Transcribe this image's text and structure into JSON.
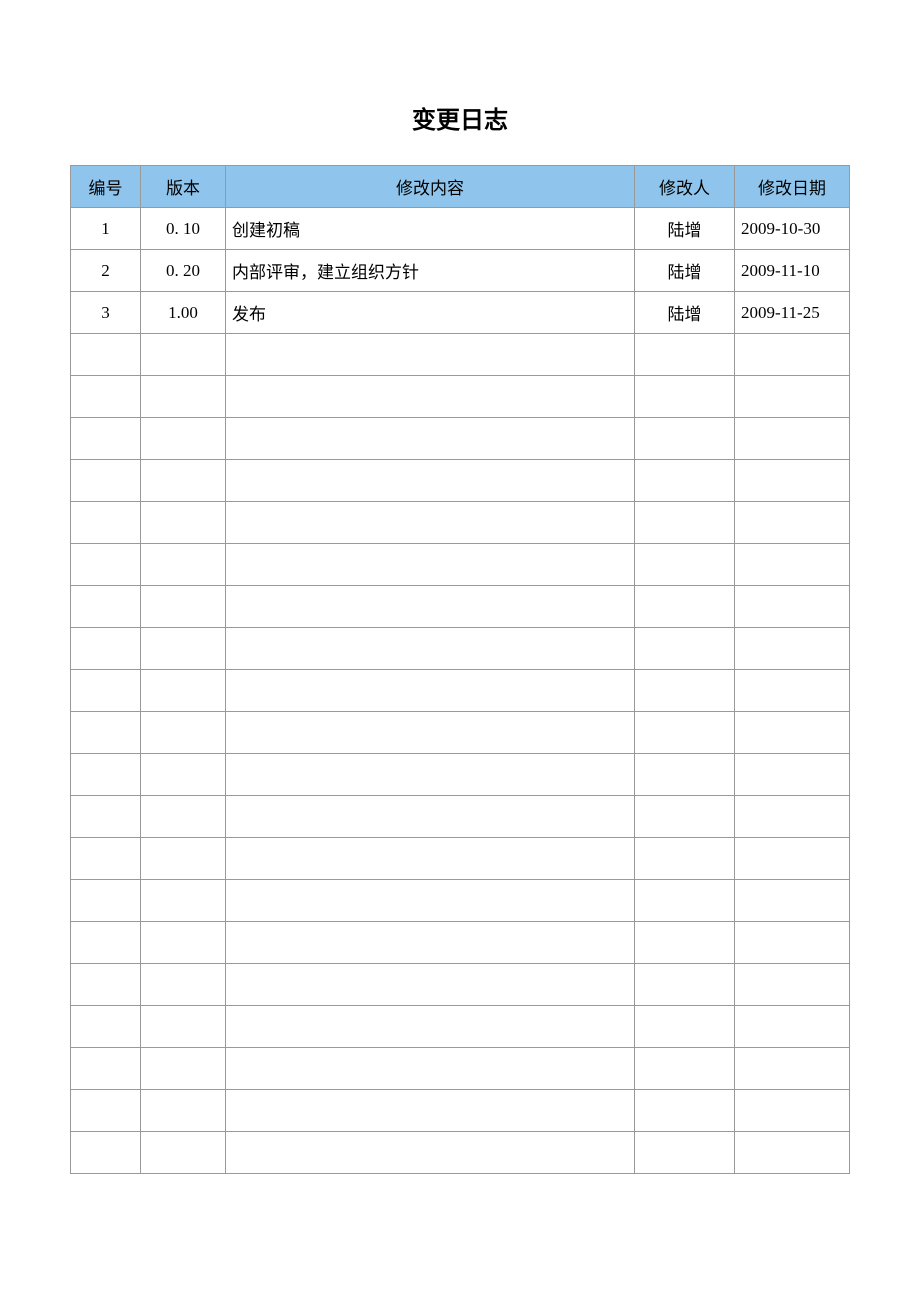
{
  "title": "变更日志",
  "headers": {
    "id": "编号",
    "version": "版本",
    "content": "修改内容",
    "author": "修改人",
    "date": "修改日期"
  },
  "rows": [
    {
      "id": "1",
      "version": "0. 10",
      "content": "创建初稿",
      "author": "陆增",
      "date": "2009-10-30"
    },
    {
      "id": "2",
      "version": "0. 20",
      "content": "内部评审，建立组织方针",
      "author": "陆增",
      "date": "2009-11-10"
    },
    {
      "id": "3",
      "version": "1.00",
      "content": "发布",
      "author": "陆增",
      "date": "2009-11-25"
    }
  ],
  "empty_row_count": 20
}
